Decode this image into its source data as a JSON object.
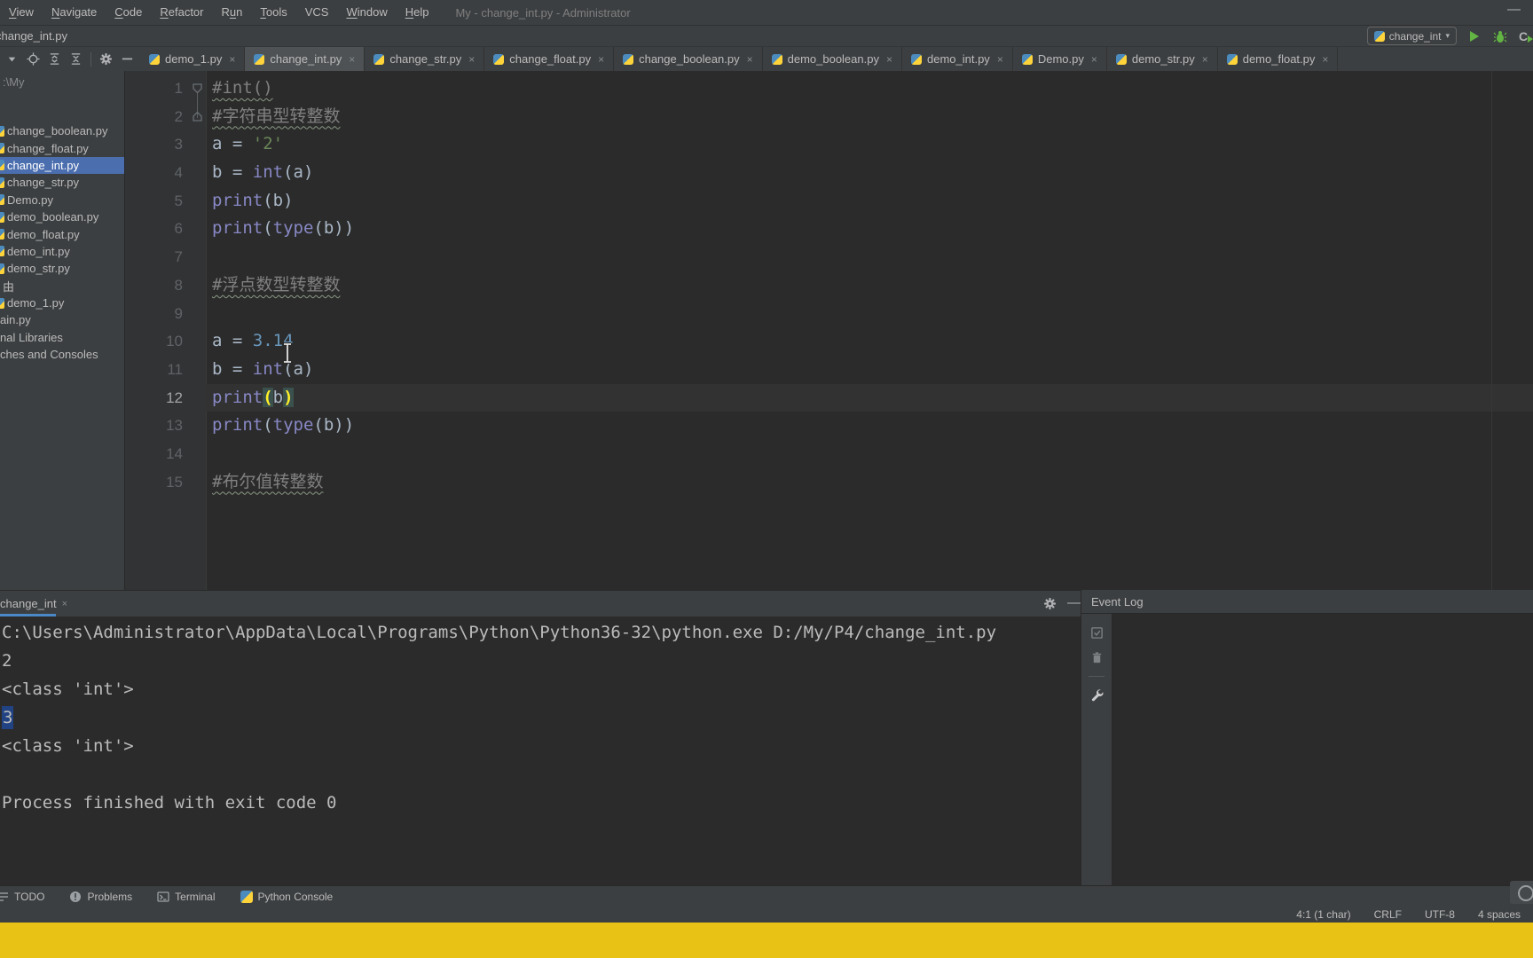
{
  "title_bar": {
    "menus": [
      {
        "label": "View",
        "mnemonic_index": 0
      },
      {
        "label": "Navigate",
        "mnemonic_index": 0
      },
      {
        "label": "Code",
        "mnemonic_index": 0
      },
      {
        "label": "Refactor",
        "mnemonic_index": 0
      },
      {
        "label": "Run",
        "mnemonic_index": 1
      },
      {
        "label": "Tools",
        "mnemonic_index": 0
      },
      {
        "label": "VCS",
        "mnemonic_index": -1
      },
      {
        "label": "Window",
        "mnemonic_index": 0
      },
      {
        "label": "Help",
        "mnemonic_index": 0
      }
    ],
    "window_title": "My - change_int.py - Administrator"
  },
  "navigation_bar": {
    "breadcrumb": "change_int.py",
    "run_config_label": "change_int"
  },
  "project_panel": {
    "root_path": ":\\My",
    "items": [
      {
        "label": "change_boolean.py",
        "type": "py"
      },
      {
        "label": "change_float.py",
        "type": "py"
      },
      {
        "label": "change_int.py",
        "type": "py",
        "selected": true
      },
      {
        "label": "change_str.py",
        "type": "py"
      },
      {
        "label": "Demo.py",
        "type": "py"
      },
      {
        "label": "demo_boolean.py",
        "type": "py"
      },
      {
        "label": "demo_float.py",
        "type": "py"
      },
      {
        "label": "demo_int.py",
        "type": "py"
      },
      {
        "label": "demo_str.py",
        "type": "py"
      },
      {
        "label": "由",
        "type": "plain"
      },
      {
        "label": "demo_1.py",
        "type": "py"
      },
      {
        "label": "ain.py",
        "type": "cut"
      },
      {
        "label": "nal Libraries",
        "type": "cut"
      },
      {
        "label": "ches and Consoles",
        "type": "cut"
      }
    ]
  },
  "editor": {
    "tabs": [
      {
        "label": "demo_1.py",
        "active": false
      },
      {
        "label": "change_int.py",
        "active": true
      },
      {
        "label": "change_str.py",
        "active": false
      },
      {
        "label": "change_float.py",
        "active": false
      },
      {
        "label": "change_boolean.py",
        "active": false
      },
      {
        "label": "demo_boolean.py",
        "active": false
      },
      {
        "label": "demo_int.py",
        "active": false
      },
      {
        "label": "Demo.py",
        "active": false
      },
      {
        "label": "demo_str.py",
        "active": false
      },
      {
        "label": "demo_float.py",
        "active": false
      }
    ],
    "lines": [
      {
        "n": 1,
        "fold": true,
        "tokens": [
          {
            "t": "#int()",
            "c": "comment typo"
          }
        ]
      },
      {
        "n": 2,
        "fold": true,
        "tokens": [
          {
            "t": "#字符串型转整数",
            "c": "comment typo"
          }
        ]
      },
      {
        "n": 3,
        "tokens": [
          {
            "t": "a = ",
            "c": "plain"
          },
          {
            "t": "'2'",
            "c": "string"
          }
        ]
      },
      {
        "n": 4,
        "tokens": [
          {
            "t": "b = ",
            "c": "plain"
          },
          {
            "t": "int",
            "c": "builtin"
          },
          {
            "t": "(a)",
            "c": "plain"
          }
        ]
      },
      {
        "n": 5,
        "tokens": [
          {
            "t": "print",
            "c": "builtin"
          },
          {
            "t": "(b)",
            "c": "plain"
          }
        ]
      },
      {
        "n": 6,
        "tokens": [
          {
            "t": "print",
            "c": "builtin"
          },
          {
            "t": "(",
            "c": "plain"
          },
          {
            "t": "type",
            "c": "builtin"
          },
          {
            "t": "(b))",
            "c": "plain"
          }
        ]
      },
      {
        "n": 7,
        "tokens": []
      },
      {
        "n": 8,
        "tokens": [
          {
            "t": "#浮点数型转整数",
            "c": "comment typo"
          }
        ]
      },
      {
        "n": 9,
        "tokens": []
      },
      {
        "n": 10,
        "tokens": [
          {
            "t": "a = ",
            "c": "plain"
          },
          {
            "t": "3.14",
            "c": "number"
          }
        ]
      },
      {
        "n": 11,
        "tokens": [
          {
            "t": "b = ",
            "c": "plain"
          },
          {
            "t": "int",
            "c": "builtin"
          },
          {
            "t": "(a)",
            "c": "plain"
          }
        ]
      },
      {
        "n": 12,
        "current": true,
        "tokens": [
          {
            "t": "print",
            "c": "builtin"
          },
          {
            "t": "(",
            "c": "paren"
          },
          {
            "t": "b",
            "c": "plain"
          },
          {
            "t": ")",
            "c": "paren"
          }
        ]
      },
      {
        "n": 13,
        "tokens": [
          {
            "t": "print",
            "c": "builtin"
          },
          {
            "t": "(",
            "c": "plain"
          },
          {
            "t": "type",
            "c": "builtin"
          },
          {
            "t": "(b))",
            "c": "plain"
          }
        ]
      },
      {
        "n": 14,
        "tokens": []
      },
      {
        "n": 15,
        "tokens": [
          {
            "t": "#布尔值转整数",
            "c": "comment typo"
          }
        ]
      }
    ]
  },
  "console": {
    "tab_label": "change_int",
    "lines": [
      {
        "text": "C:\\Users\\Administrator\\AppData\\Local\\Programs\\Python\\Python36-32\\python.exe D:/My/P4/change_int.py"
      },
      {
        "text": "2"
      },
      {
        "text": "<class 'int'>"
      },
      {
        "text": "3",
        "selected": true
      },
      {
        "text": "<class 'int'>"
      },
      {
        "text": ""
      },
      {
        "text": "Process finished with exit code 0"
      }
    ]
  },
  "event_log": {
    "title": "Event Log"
  },
  "tool_window_bar": {
    "items": [
      {
        "label": "TODO"
      },
      {
        "label": "Problems"
      },
      {
        "label": "Terminal"
      },
      {
        "label": "Python Console"
      }
    ]
  },
  "status_bar": {
    "items": [
      "4:1 (1 char)",
      "CRLF",
      "UTF-8",
      "4 spaces"
    ]
  },
  "glyphs": {
    "close": "×",
    "caret_down": "▾",
    "minimize": "—"
  },
  "colors": {
    "panel_bg": "#3c3f41",
    "editor_bg": "#2b2b2b",
    "tree_selection": "#4b6eaf",
    "console_selection": "#214283",
    "tab_underline": "#4a88c7",
    "run_green": "#62b543",
    "yellow_strip": "#e9c216",
    "comment": "#808080",
    "string": "#6a8759",
    "number": "#6897bb",
    "builtin": "#8888c6",
    "matched_paren": "#ffef28"
  }
}
